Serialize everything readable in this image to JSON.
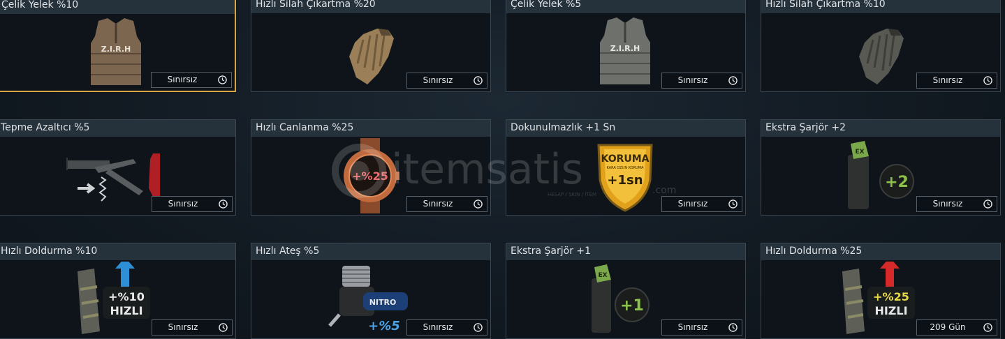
{
  "items": [
    {
      "name": "Çelik Yelek %10",
      "duration": "Sınırsız",
      "icon": "vest-icon",
      "selected": true
    },
    {
      "name": "Hızlı Silah Çıkartma %20",
      "duration": "Sınırsız",
      "icon": "glove-icon"
    },
    {
      "name": "Çelik Yelek %5",
      "duration": "Sınırsız",
      "icon": "vest-icon"
    },
    {
      "name": "Hızlı Silah Çıkartma %10",
      "duration": "Sınırsız",
      "icon": "glove-icon"
    },
    {
      "name": "Tepme Azaltıcı %5",
      "duration": "Sınırsız",
      "icon": "stock-icon"
    },
    {
      "name": "Hızlı Canlanma %25",
      "duration": "Sınırsız",
      "icon": "watch-icon"
    },
    {
      "name": "Dokunulmazlık +1 Sn",
      "duration": "Sınırsız",
      "icon": "shield-icon"
    },
    {
      "name": "Ekstra Şarjör +2",
      "duration": "Sınırsız",
      "icon": "mag-pouch-icon"
    },
    {
      "name": "Hızlı Doldurma %10",
      "duration": "Sınırsız",
      "icon": "magazine-icon"
    },
    {
      "name": "Hızlı Ateş %5",
      "duration": "Sınırsız",
      "icon": "engine-icon"
    },
    {
      "name": "Ekstra Şarjör +1",
      "duration": "Sınırsız",
      "icon": "mag-pouch-icon"
    },
    {
      "name": "Hızlı Doldurma %25",
      "duration": "209 Gün",
      "icon": "magazine-icon"
    }
  ],
  "art": {
    "vest_text": "Z.I.R.H",
    "watch_text": "+%25",
    "shield_top": "KORUMA",
    "shield_small": "KARA OZUN KORUMA",
    "shield_value": "+1sn",
    "pouch_tag": "EX",
    "pouch_plus2": "+2",
    "pouch_plus1": "+1",
    "mag10_value": "+%10",
    "mag_speed": "HIZLI",
    "mag25_value": "+%25",
    "engine_brand": "NITRO",
    "engine_value": "+%5"
  },
  "watermark": {
    "brand": "itemsatis",
    "tld": ".com",
    "tagline": "HESAP / SKIN / İTEM"
  },
  "colors": {
    "selected_border": "#d9a441",
    "title_bar": "#25313b",
    "card_border": "#3a4753",
    "up_arrow_blue": "#2e8fd6",
    "up_arrow_red": "#d62a2a"
  }
}
